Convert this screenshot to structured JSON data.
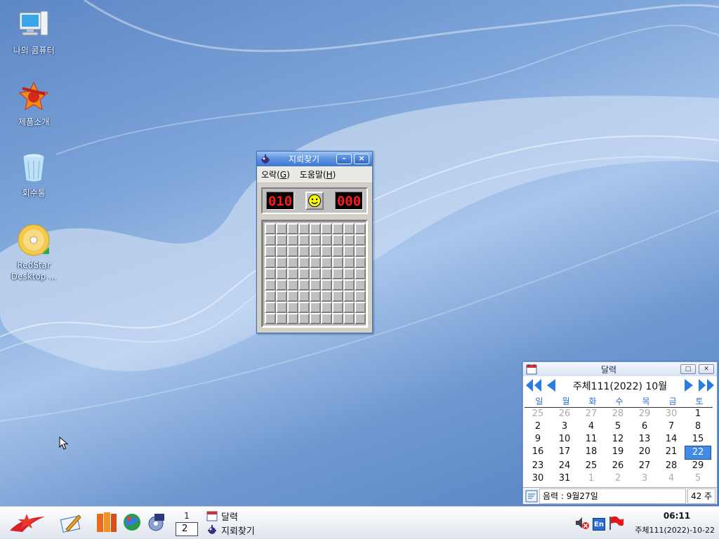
{
  "desktop": {
    "icons": [
      {
        "label": "나의 콤퓨터",
        "icon": "computer-icon"
      },
      {
        "label": "제품소개",
        "icon": "product-intro-icon"
      },
      {
        "label": "회수통",
        "icon": "recycle-bin-icon"
      },
      {
        "label_line1": "RedStar",
        "label_line2": "Desktop ...",
        "icon": "dvd-disc-icon"
      }
    ]
  },
  "minesweeper": {
    "title": "지뢰찾기",
    "menu_game": "오락",
    "menu_game_key": "G",
    "menu_help": "도움말",
    "menu_help_key": "H",
    "mines_left": "010",
    "timer": "000",
    "rows": 9,
    "cols": 9,
    "face": "smiley-face-icon"
  },
  "calendar": {
    "title": "달력",
    "month_label": "주체111(2022) 10월",
    "weekdays": [
      "일",
      "월",
      "화",
      "수",
      "목",
      "금",
      "토"
    ],
    "weeks": [
      [
        "25",
        "26",
        "27",
        "28",
        "29",
        "30",
        "1"
      ],
      [
        "2",
        "3",
        "4",
        "5",
        "6",
        "7",
        "8"
      ],
      [
        "9",
        "10",
        "11",
        "12",
        "13",
        "14",
        "15"
      ],
      [
        "16",
        "17",
        "18",
        "19",
        "20",
        "21",
        "22"
      ],
      [
        "23",
        "24",
        "25",
        "26",
        "27",
        "28",
        "29"
      ],
      [
        "30",
        "31",
        "1",
        "2",
        "3",
        "4",
        "5"
      ]
    ],
    "today": "22",
    "lunar": "음력 : 9월27일",
    "week_number": "42 주",
    "accent_color": "#3f8be6"
  },
  "taskbar": {
    "pager_top": "1",
    "pager_current": "2",
    "tasks": [
      {
        "label": "달력",
        "icon": "calendar-icon"
      },
      {
        "label": "지뢰찾기",
        "icon": "minesweeper-icon"
      }
    ],
    "lang": "En",
    "time": "06:11",
    "date": "주체111(2022)-10-22"
  }
}
